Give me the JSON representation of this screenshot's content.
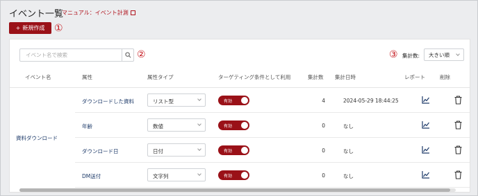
{
  "header": {
    "title": "イベント一覧",
    "manual_link": "マニュアル：イベント計測",
    "new_button": "新規作成"
  },
  "markers": [
    "①",
    "②",
    "③"
  ],
  "toolbar": {
    "search_placeholder": "イベント名で検索",
    "sort_label": "集計数:",
    "sort_value": "大きい順"
  },
  "table": {
    "columns": [
      "イベント名",
      "属性",
      "属性タイプ",
      "ターゲティング条件として利用",
      "集計数",
      "集計日時",
      "レポート",
      "削除"
    ],
    "event_name": "資料ダウンロード",
    "rows": [
      {
        "attr": "ダウンロードした資料",
        "type": "リスト型",
        "toggle": "有効",
        "count": "4",
        "date": "2024-05-29 18:44:25"
      },
      {
        "attr": "年齢",
        "type": "数値",
        "toggle": "有効",
        "count": "0",
        "date": "なし"
      },
      {
        "attr": "ダウンロード日",
        "type": "日付",
        "toggle": "有効",
        "count": "0",
        "date": "なし"
      },
      {
        "attr": "DM送付",
        "type": "文字列",
        "toggle": "有効",
        "count": "0",
        "date": "なし"
      }
    ]
  },
  "colors": {
    "brand": "#9a1118",
    "link": "#1d3a69",
    "marker": "#c4161c"
  },
  "icons": [
    "external-link-icon",
    "plus-icon",
    "search-icon",
    "chevron-down-icon",
    "chart-icon",
    "trash-icon"
  ]
}
